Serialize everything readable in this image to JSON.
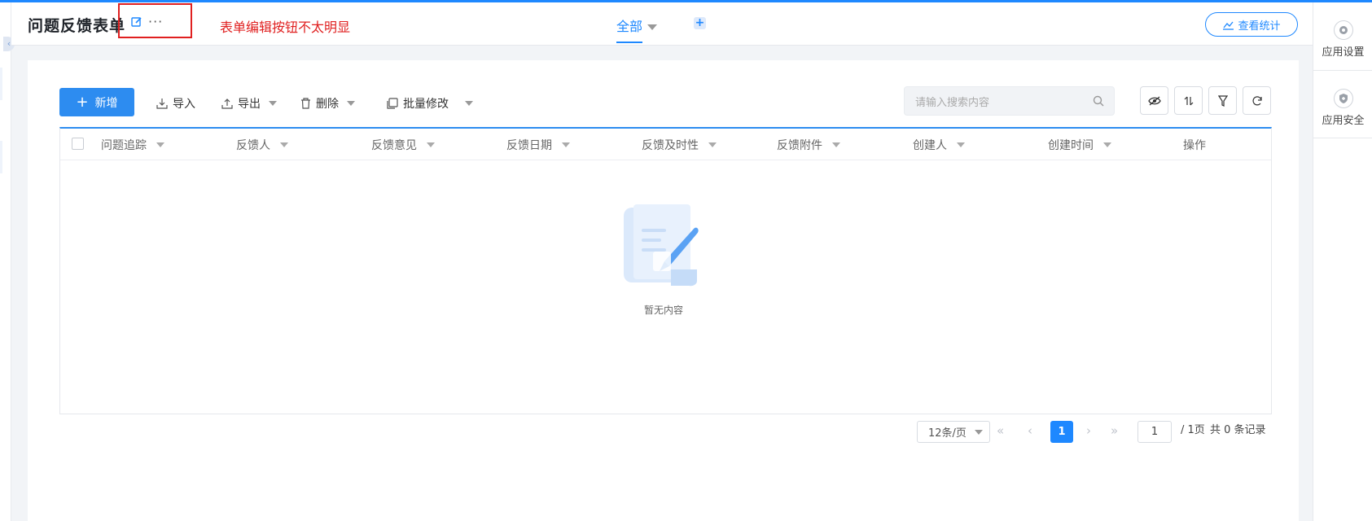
{
  "header": {
    "title": "问题反馈表单",
    "more_label": "···",
    "annotation": "表单编辑按钮不太明显",
    "tab_all": "全部",
    "tab_add": "+",
    "stats_button": "查看统计"
  },
  "right_panel": {
    "app_settings": "应用设置",
    "app_security": "应用安全"
  },
  "toolbar": {
    "new_button": "新增",
    "import": "导入",
    "export": "导出",
    "delete": "删除",
    "batch_edit": "批量修改",
    "search_placeholder": "请输入搜索内容"
  },
  "table": {
    "columns": [
      "问题追踪",
      "反馈人",
      "反馈意见",
      "反馈日期",
      "反馈及时性",
      "反馈附件",
      "创建人",
      "创建时间",
      "操作"
    ],
    "rows": [],
    "empty_text": "暂无内容"
  },
  "pagination": {
    "page_size": "12条/页",
    "current_page": "1",
    "jump_value": "1",
    "total_pages_label": "/ 1页",
    "total_records_label": "共 0 条记录"
  },
  "colors": {
    "primary": "#1e88ff",
    "annotation_red": "#e02020"
  }
}
